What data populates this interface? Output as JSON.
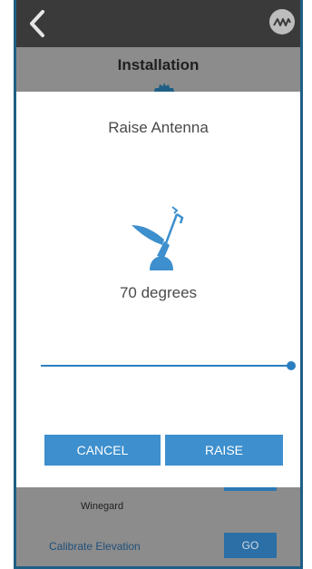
{
  "header": {
    "back_icon": "chevron-left-icon",
    "logo_icon": "winegard-logo-icon"
  },
  "page": {
    "title": "Installation",
    "winegard_label": "Winegard",
    "calibrate_label": "Calibrate Elevation",
    "go_label": "GO"
  },
  "dialog": {
    "title": "Raise Antenna",
    "icon": "antenna-icon",
    "degrees_text": "70 degrees",
    "slider_value": 1.0,
    "cancel_label": "CANCEL",
    "raise_label": "RAISE"
  },
  "colors": {
    "accent": "#3d8fcd",
    "topbar": "#3a3a3a",
    "frame": "#1f5f86"
  }
}
